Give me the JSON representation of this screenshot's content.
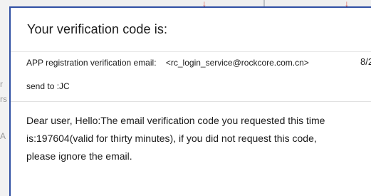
{
  "email": {
    "subject": "Your verification code is:",
    "from_label": "APP registration verification email:",
    "from_email": "<rc_login_service@rockcore.com.cn>",
    "date_partial": "8/2",
    "to_label": "send to :JC",
    "body_lines": [
      "Dear user, Hello:The email verification code you requested this time",
      "is:197604(valid for thirty minutes), if you did not request this code,",
      "please ignore the email."
    ]
  },
  "colors": {
    "panel_border": "#2f4fa3",
    "arrow_red": "#d33b2f"
  }
}
